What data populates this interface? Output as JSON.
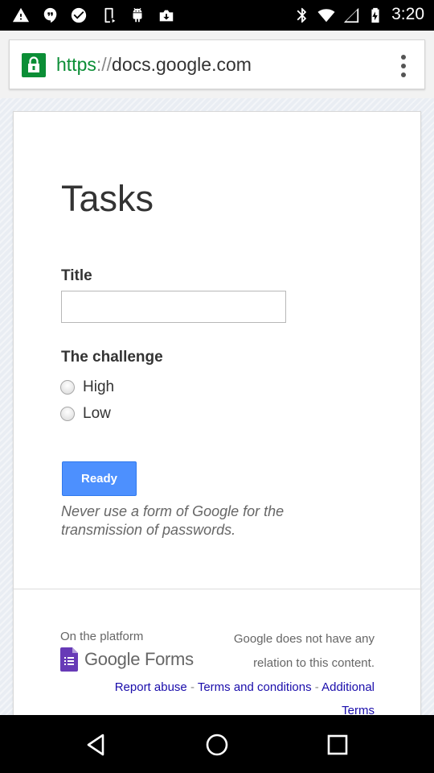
{
  "status_bar": {
    "time": "3:20",
    "icons": [
      "warning-icon",
      "hangouts-icon",
      "check-circle-icon",
      "phone-icon",
      "android-icon",
      "download-box-icon",
      "bluetooth-icon",
      "wifi-icon",
      "signal-icon",
      "battery-charging-icon"
    ]
  },
  "browser": {
    "url_scheme": "https",
    "url_separator": "://",
    "url_host": "docs.google.com",
    "secure": true,
    "accent_color": "#0b8e36"
  },
  "form": {
    "title": "Tasks",
    "fields": {
      "title_label": "Title",
      "title_value": "",
      "challenge_label": "The challenge",
      "options": [
        "High",
        "Low"
      ]
    },
    "submit_label": "Ready",
    "warning": "Never use a form of Google for the transmission of passwords.",
    "button_color": "#4d90fe"
  },
  "footer": {
    "platform_label": "On the platform",
    "brand": "Google Forms",
    "disclaimer_line1": "Google does not have any",
    "disclaimer_line2": "relation to this content.",
    "links": [
      "Report abuse",
      "Terms and conditions",
      "Additional"
    ],
    "links_continued": "Terms",
    "separator": "-"
  },
  "nav_bar": {
    "icons": [
      "back-icon",
      "home-icon",
      "recents-icon"
    ]
  }
}
